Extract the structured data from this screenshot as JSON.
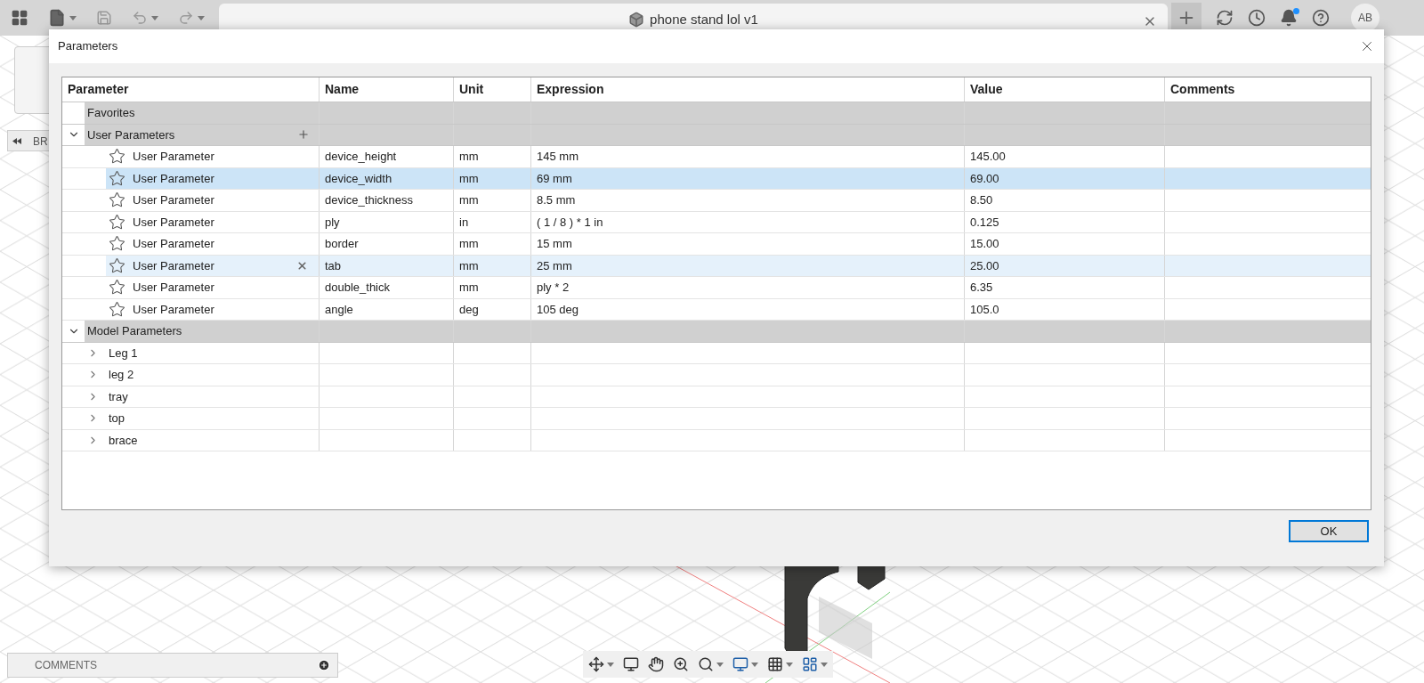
{
  "app": {
    "document_title": "phone stand lol v1",
    "avatar": "AB",
    "browser_label": "BR",
    "comments_label": "COMMENTS"
  },
  "dialog": {
    "title": "Parameters",
    "columns": [
      "Parameter",
      "Name",
      "Unit",
      "Expression",
      "Value",
      "Comments"
    ],
    "groups": [
      {
        "kind": "favorites",
        "label": "Favorites"
      },
      {
        "kind": "user",
        "label": "User Parameters",
        "expanded": true,
        "rows": [
          {
            "parameter": "User Parameter",
            "name": "device_height",
            "unit": "mm",
            "expression": "145 mm",
            "value": "145.00",
            "selected": false,
            "hovered": false
          },
          {
            "parameter": "User Parameter",
            "name": "device_width",
            "unit": "mm",
            "expression": "69 mm",
            "value": "69.00",
            "selected": true,
            "hovered": false
          },
          {
            "parameter": "User Parameter",
            "name": "device_thickness",
            "unit": "mm",
            "expression": "8.5 mm",
            "value": "8.50",
            "selected": false,
            "hovered": false
          },
          {
            "parameter": "User Parameter",
            "name": "ply",
            "unit": "in",
            "expression": "( 1 / 8 ) * 1 in",
            "value": "0.125",
            "selected": false,
            "hovered": false
          },
          {
            "parameter": "User Parameter",
            "name": "border",
            "unit": "mm",
            "expression": "15 mm",
            "value": "15.00",
            "selected": false,
            "hovered": false
          },
          {
            "parameter": "User Parameter",
            "name": "tab",
            "unit": "mm",
            "expression": "25 mm",
            "value": "25.00",
            "selected": false,
            "hovered": true
          },
          {
            "parameter": "User Parameter",
            "name": "double_thick",
            "unit": "mm",
            "expression": "ply * 2",
            "value": "6.35",
            "selected": false,
            "hovered": false
          },
          {
            "parameter": "User Parameter",
            "name": "angle",
            "unit": "deg",
            "expression": "105 deg",
            "value": "105.0",
            "selected": false,
            "hovered": false
          }
        ]
      },
      {
        "kind": "model",
        "label": "Model Parameters",
        "expanded": true,
        "children": [
          {
            "label": "Leg 1",
            "expanded": false
          },
          {
            "label": "leg 2",
            "expanded": false
          },
          {
            "label": "tray",
            "expanded": false
          },
          {
            "label": "top",
            "expanded": false
          },
          {
            "label": "brace",
            "expanded": false
          }
        ]
      }
    ],
    "ok_button": "OK"
  }
}
